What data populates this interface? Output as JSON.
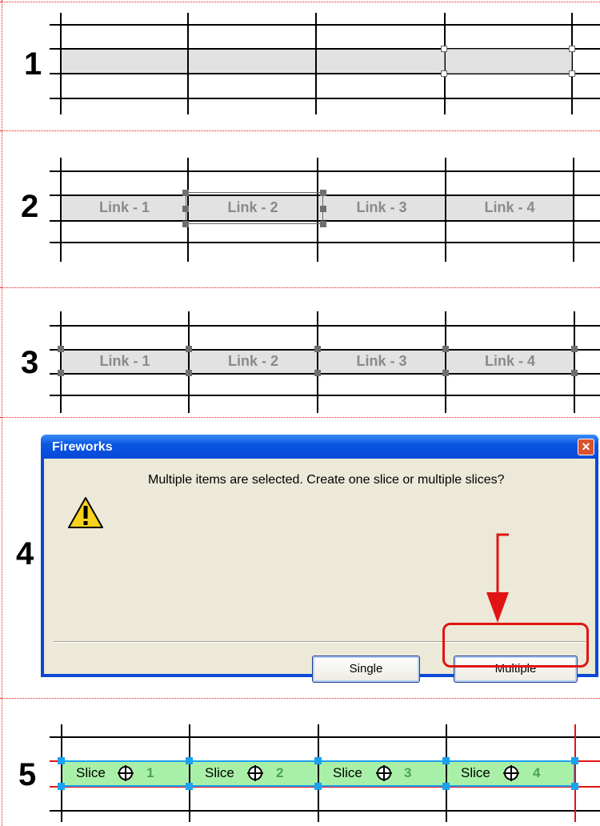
{
  "steps": [
    "1",
    "2",
    "3",
    "4",
    "5"
  ],
  "step2": {
    "links": [
      "Link - 1",
      "Link - 2",
      "Link - 3",
      "Link - 4"
    ]
  },
  "step3": {
    "links": [
      "Link - 1",
      "Link - 2",
      "Link - 3",
      "Link - 4"
    ]
  },
  "dialog": {
    "title": "Fireworks",
    "close_label": "✕",
    "icon": "warning-icon",
    "message": "Multiple items are selected. Create one slice or multiple slices?",
    "buttons": {
      "single": "Single",
      "multiple": "Multiple"
    }
  },
  "step5": {
    "slices": [
      {
        "label": "Slice",
        "num": "1"
      },
      {
        "label": "Slice",
        "num": "2"
      },
      {
        "label": "Slice",
        "num": "3"
      },
      {
        "label": "Slice",
        "num": "4"
      }
    ]
  },
  "colors": {
    "guide_line": "#000000",
    "separator": "#e02020",
    "bar_fill": "#e2e2e2",
    "slice_fill": "#a8f0a8",
    "slice_handle": "#19a2f0",
    "highlight": "#e01414",
    "dialog_title": "#0a57e3"
  }
}
